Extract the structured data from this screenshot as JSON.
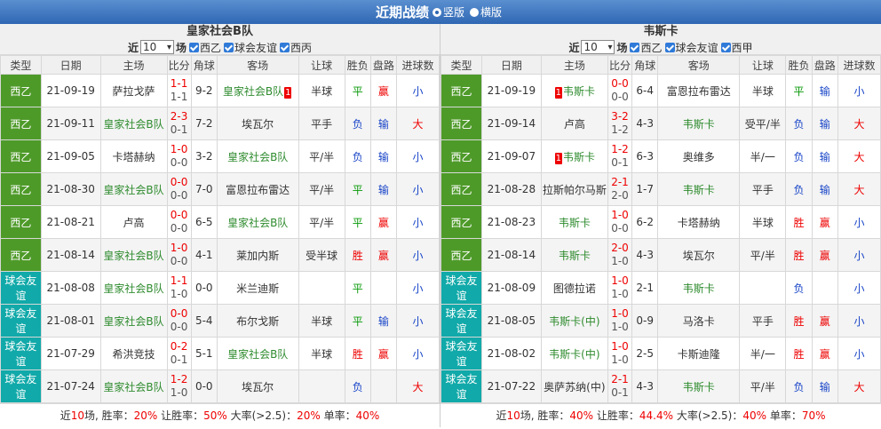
{
  "header": {
    "title": "近期战绩",
    "layout_options": [
      {
        "label": "竖版",
        "selected": true
      },
      {
        "label": "横版",
        "selected": false
      }
    ]
  },
  "columns": [
    "类型",
    "日期",
    "主场",
    "比分",
    "角球",
    "客场",
    "让球",
    "胜负",
    "盘路",
    "进球数"
  ],
  "panels": [
    {
      "team": "皇家社会B队",
      "filter": {
        "prefix": "近",
        "count": "10",
        "suffix": "场",
        "checks": [
          "西乙",
          "球会友谊",
          "西丙"
        ]
      },
      "rows": [
        {
          "type": "西乙",
          "kind": "league",
          "date": "21-09-19",
          "home": "萨拉戈萨",
          "home_red": "",
          "home_is_team": false,
          "score_ft": "1-1",
          "score_ht": "1-1",
          "corner": "9-2",
          "away": "皇家社会B队",
          "away_red": "1",
          "away_is_team": true,
          "handicap": "半球",
          "result": "平",
          "result_class": "draw",
          "hc": "赢",
          "hc_class": "hc-win",
          "ou": "小",
          "ou_class": "ou-small"
        },
        {
          "type": "西乙",
          "kind": "league",
          "date": "21-09-11",
          "home": "皇家社会B队",
          "home_red": "",
          "home_is_team": true,
          "score_ft": "2-3",
          "score_ht": "0-1",
          "corner": "7-2",
          "away": "埃瓦尔",
          "away_red": "",
          "away_is_team": false,
          "handicap": "平手",
          "result": "负",
          "result_class": "lose",
          "hc": "输",
          "hc_class": "hc-lose",
          "ou": "大",
          "ou_class": "ou-big"
        },
        {
          "type": "西乙",
          "kind": "league",
          "date": "21-09-05",
          "home": "卡塔赫纳",
          "home_red": "",
          "home_is_team": false,
          "score_ft": "1-0",
          "score_ht": "0-0",
          "corner": "3-2",
          "away": "皇家社会B队",
          "away_red": "",
          "away_is_team": true,
          "handicap": "平/半",
          "result": "负",
          "result_class": "lose",
          "hc": "输",
          "hc_class": "hc-lose",
          "ou": "小",
          "ou_class": "ou-small"
        },
        {
          "type": "西乙",
          "kind": "league",
          "date": "21-08-30",
          "home": "皇家社会B队",
          "home_red": "",
          "home_is_team": true,
          "score_ft": "0-0",
          "score_ht": "0-0",
          "corner": "7-0",
          "away": "富恩拉布雷达",
          "away_red": "",
          "away_is_team": false,
          "handicap": "平/半",
          "result": "平",
          "result_class": "draw",
          "hc": "输",
          "hc_class": "hc-lose",
          "ou": "小",
          "ou_class": "ou-small"
        },
        {
          "type": "西乙",
          "kind": "league",
          "date": "21-08-21",
          "home": "卢高",
          "home_red": "",
          "home_is_team": false,
          "score_ft": "0-0",
          "score_ht": "0-0",
          "corner": "6-5",
          "away": "皇家社会B队",
          "away_red": "",
          "away_is_team": true,
          "handicap": "平/半",
          "result": "平",
          "result_class": "draw",
          "hc": "赢",
          "hc_class": "hc-win",
          "ou": "小",
          "ou_class": "ou-small"
        },
        {
          "type": "西乙",
          "kind": "league",
          "date": "21-08-14",
          "home": "皇家社会B队",
          "home_red": "",
          "home_is_team": true,
          "score_ft": "1-0",
          "score_ht": "0-0",
          "corner": "4-1",
          "away": "莱加内斯",
          "away_red": "",
          "away_is_team": false,
          "handicap": "受半球",
          "result": "胜",
          "result_class": "win",
          "hc": "赢",
          "hc_class": "hc-win",
          "ou": "小",
          "ou_class": "ou-small"
        },
        {
          "type": "球会友谊",
          "kind": "friendly",
          "date": "21-08-08",
          "home": "皇家社会B队",
          "home_red": "",
          "home_is_team": true,
          "score_ft": "1-1",
          "score_ht": "1-0",
          "corner": "0-0",
          "away": "米兰迪斯",
          "away_red": "",
          "away_is_team": false,
          "handicap": "",
          "result": "平",
          "result_class": "draw",
          "hc": "",
          "hc_class": "",
          "ou": "小",
          "ou_class": "ou-small"
        },
        {
          "type": "球会友谊",
          "kind": "friendly",
          "date": "21-08-01",
          "home": "皇家社会B队",
          "home_red": "",
          "home_is_team": true,
          "score_ft": "0-0",
          "score_ht": "0-0",
          "corner": "5-4",
          "away": "布尔戈斯",
          "away_red": "",
          "away_is_team": false,
          "handicap": "半球",
          "result": "平",
          "result_class": "draw",
          "hc": "输",
          "hc_class": "hc-lose",
          "ou": "小",
          "ou_class": "ou-small"
        },
        {
          "type": "球会友谊",
          "kind": "friendly",
          "date": "21-07-29",
          "home": "希洪竞技",
          "home_red": "",
          "home_is_team": false,
          "score_ft": "0-2",
          "score_ht": "0-1",
          "corner": "5-1",
          "away": "皇家社会B队",
          "away_red": "",
          "away_is_team": true,
          "handicap": "半球",
          "result": "胜",
          "result_class": "win",
          "hc": "赢",
          "hc_class": "hc-win",
          "ou": "小",
          "ou_class": "ou-small"
        },
        {
          "type": "球会友谊",
          "kind": "friendly",
          "date": "21-07-24",
          "home": "皇家社会B队",
          "home_red": "",
          "home_is_team": true,
          "score_ft": "1-2",
          "score_ht": "1-0",
          "corner": "0-0",
          "away": "埃瓦尔",
          "away_red": "",
          "away_is_team": false,
          "handicap": "",
          "result": "负",
          "result_class": "lose",
          "hc": "",
          "hc_class": "",
          "ou": "大",
          "ou_class": "ou-big"
        }
      ],
      "summary": {
        "prefix": "近",
        "count": "10",
        "games_suffix": "场, 胜率：",
        "win_rate": "20%",
        "hc_label": " 让胜率：",
        "hc_rate": "50%",
        "big_label": " 大率(>2.5)：",
        "big_rate": "20%",
        "odd_label": " 单率：",
        "odd_rate": "40%"
      }
    },
    {
      "team": "韦斯卡",
      "filter": {
        "prefix": "近",
        "count": "10",
        "suffix": "场",
        "checks": [
          "西乙",
          "球会友谊",
          "西甲"
        ]
      },
      "rows": [
        {
          "type": "西乙",
          "kind": "league",
          "date": "21-09-19",
          "home": "韦斯卡",
          "home_red": "1",
          "home_is_team": true,
          "score_ft": "0-0",
          "score_ht": "0-0",
          "corner": "6-4",
          "away": "富恩拉布雷达",
          "away_red": "",
          "away_is_team": false,
          "handicap": "半球",
          "result": "平",
          "result_class": "draw",
          "hc": "输",
          "hc_class": "hc-lose",
          "ou": "小",
          "ou_class": "ou-small"
        },
        {
          "type": "西乙",
          "kind": "league",
          "date": "21-09-14",
          "home": "卢高",
          "home_red": "",
          "home_is_team": false,
          "score_ft": "3-2",
          "score_ht": "1-2",
          "corner": "4-3",
          "away": "韦斯卡",
          "away_red": "",
          "away_is_team": true,
          "handicap": "受平/半",
          "result": "负",
          "result_class": "lose",
          "hc": "输",
          "hc_class": "hc-lose",
          "ou": "大",
          "ou_class": "ou-big"
        },
        {
          "type": "西乙",
          "kind": "league",
          "date": "21-09-07",
          "home": "韦斯卡",
          "home_red": "1",
          "home_is_team": true,
          "score_ft": "1-2",
          "score_ht": "0-1",
          "corner": "6-3",
          "away": "奥维多",
          "away_red": "",
          "away_is_team": false,
          "handicap": "半/一",
          "result": "负",
          "result_class": "lose",
          "hc": "输",
          "hc_class": "hc-lose",
          "ou": "大",
          "ou_class": "ou-big"
        },
        {
          "type": "西乙",
          "kind": "league",
          "date": "21-08-28",
          "home": "拉斯帕尔马斯",
          "home_red": "",
          "home_is_team": false,
          "score_ft": "2-1",
          "score_ht": "2-0",
          "corner": "1-7",
          "away": "韦斯卡",
          "away_red": "",
          "away_is_team": true,
          "handicap": "平手",
          "result": "负",
          "result_class": "lose",
          "hc": "输",
          "hc_class": "hc-lose",
          "ou": "大",
          "ou_class": "ou-big"
        },
        {
          "type": "西乙",
          "kind": "league",
          "date": "21-08-23",
          "home": "韦斯卡",
          "home_red": "",
          "home_is_team": true,
          "score_ft": "1-0",
          "score_ht": "0-0",
          "corner": "6-2",
          "away": "卡塔赫纳",
          "away_red": "",
          "away_is_team": false,
          "handicap": "半球",
          "result": "胜",
          "result_class": "win",
          "hc": "赢",
          "hc_class": "hc-win",
          "ou": "小",
          "ou_class": "ou-small"
        },
        {
          "type": "西乙",
          "kind": "league",
          "date": "21-08-14",
          "home": "韦斯卡",
          "home_red": "",
          "home_is_team": true,
          "score_ft": "2-0",
          "score_ht": "1-0",
          "corner": "4-3",
          "away": "埃瓦尔",
          "away_red": "",
          "away_is_team": false,
          "handicap": "平/半",
          "result": "胜",
          "result_class": "win",
          "hc": "赢",
          "hc_class": "hc-win",
          "ou": "小",
          "ou_class": "ou-small"
        },
        {
          "type": "球会友谊",
          "kind": "friendly",
          "date": "21-08-09",
          "home": "图德拉诺",
          "home_red": "",
          "home_is_team": false,
          "score_ft": "1-0",
          "score_ht": "1-0",
          "corner": "2-1",
          "away": "韦斯卡",
          "away_red": "",
          "away_is_team": true,
          "handicap": "",
          "result": "负",
          "result_class": "lose",
          "hc": "",
          "hc_class": "",
          "ou": "小",
          "ou_class": "ou-small"
        },
        {
          "type": "球会友谊",
          "kind": "friendly",
          "date": "21-08-05",
          "home": "韦斯卡(中)",
          "home_red": "",
          "home_is_team": true,
          "score_ft": "1-0",
          "score_ht": "1-0",
          "corner": "0-9",
          "away": "马洛卡",
          "away_red": "",
          "away_is_team": false,
          "handicap": "平手",
          "result": "胜",
          "result_class": "win",
          "hc": "赢",
          "hc_class": "hc-win",
          "ou": "小",
          "ou_class": "ou-small"
        },
        {
          "type": "球会友谊",
          "kind": "friendly",
          "date": "21-08-02",
          "home": "韦斯卡(中)",
          "home_red": "",
          "home_is_team": true,
          "score_ft": "1-0",
          "score_ht": "1-0",
          "corner": "2-5",
          "away": "卡斯迪隆",
          "away_red": "",
          "away_is_team": false,
          "handicap": "半/一",
          "result": "胜",
          "result_class": "win",
          "hc": "赢",
          "hc_class": "hc-win",
          "ou": "小",
          "ou_class": "ou-small"
        },
        {
          "type": "球会友谊",
          "kind": "friendly",
          "date": "21-07-22",
          "home": "奥萨苏纳(中)",
          "home_red": "",
          "home_is_team": false,
          "score_ft": "2-1",
          "score_ht": "0-1",
          "corner": "4-3",
          "away": "韦斯卡",
          "away_red": "",
          "away_is_team": true,
          "handicap": "平/半",
          "result": "负",
          "result_class": "lose",
          "hc": "输",
          "hc_class": "hc-lose",
          "ou": "大",
          "ou_class": "ou-big"
        }
      ],
      "summary": {
        "prefix": "近",
        "count": "10",
        "games_suffix": "场, 胜率：",
        "win_rate": "40%",
        "hc_label": " 让胜率：",
        "hc_rate": "44.4%",
        "big_label": " 大率(>2.5)：",
        "big_rate": "40%",
        "odd_label": " 单率：",
        "odd_rate": "70%"
      }
    }
  ]
}
